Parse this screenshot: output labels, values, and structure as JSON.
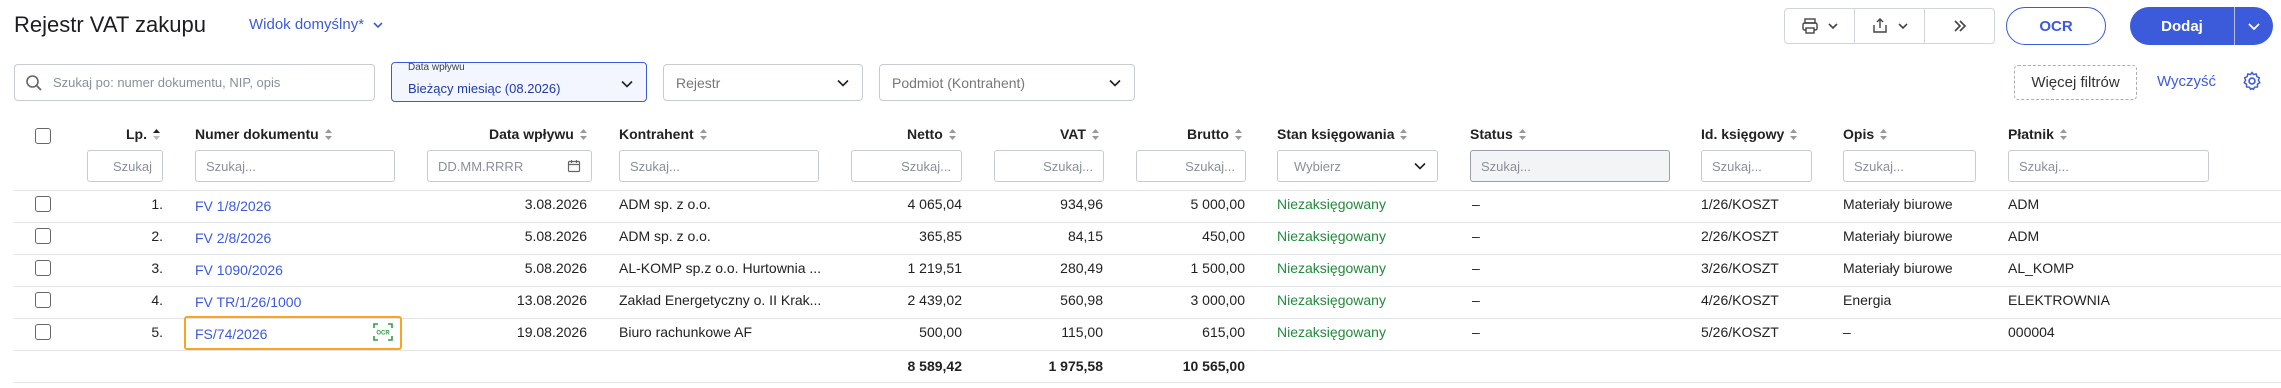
{
  "header": {
    "title": "Rejestr VAT zakupu",
    "view": "Widok domyślny*",
    "ocr_button": "OCR",
    "add_button": "Dodaj"
  },
  "filters": {
    "search_placeholder": "Szukaj po: numer dokumentu, NIP, opis",
    "date_label": "Data wpływu",
    "date_value": "Bieżący miesiąc (08.2026)",
    "register_placeholder": "Rejestr",
    "entity_placeholder": "Podmiot (Kontrahent)",
    "more_filters": "Więcej filtrów",
    "clear": "Wyczyść"
  },
  "columns": {
    "lp": "Lp.",
    "doc_number": "Numer dokumentu",
    "date": "Data wpływu",
    "contractor": "Kontrahent",
    "net": "Netto",
    "vat": "VAT",
    "gross": "Brutto",
    "status_booking": "Stan księgowania",
    "status": "Status",
    "id": "Id. księgowy",
    "desc": "Opis",
    "payer": "Płatnik"
  },
  "column_filters": {
    "lp": "Szukaj",
    "generic": "Szukaj...",
    "date": "DD.MM.RRRR",
    "select": "Wybierz"
  },
  "rows": [
    {
      "lp": "1.",
      "doc": "FV 1/8/2026",
      "date": "3.08.2026",
      "contractor": "ADM sp. z o.o.",
      "net": "4 065,04",
      "vat": "934,96",
      "gross": "5 000,00",
      "booking": "Niezaksięgowany",
      "status": "–",
      "id": "1/26/KOSZT",
      "desc": "Materiały biurowe",
      "payer": "ADM"
    },
    {
      "lp": "2.",
      "doc": "FV 2/8/2026",
      "date": "5.08.2026",
      "contractor": "ADM sp. z o.o.",
      "net": "365,85",
      "vat": "84,15",
      "gross": "450,00",
      "booking": "Niezaksięgowany",
      "status": "–",
      "id": "2/26/KOSZT",
      "desc": "Materiały biurowe",
      "payer": "ADM"
    },
    {
      "lp": "3.",
      "doc": "FV 1090/2026",
      "date": "5.08.2026",
      "contractor": "AL-KOMP sp.z o.o. Hurtownia ...",
      "net": "1 219,51",
      "vat": "280,49",
      "gross": "1 500,00",
      "booking": "Niezaksięgowany",
      "status": "–",
      "id": "3/26/KOSZT",
      "desc": "Materiały biurowe",
      "payer": "AL_KOMP"
    },
    {
      "lp": "4.",
      "doc": "FV TR/1/26/1000",
      "date": "13.08.2026",
      "contractor": "Zakład Energetyczny o. II Krak...",
      "net": "2 439,02",
      "vat": "560,98",
      "gross": "3 000,00",
      "booking": "Niezaksięgowany",
      "status": "–",
      "id": "4/26/KOSZT",
      "desc": "Energia",
      "payer": "ELEKTROWNIA"
    },
    {
      "lp": "5.",
      "doc": "FS/74/2026",
      "date": "19.08.2026",
      "contractor": "Biuro rachunkowe AF",
      "net": "500,00",
      "vat": "115,00",
      "gross": "615,00",
      "booking": "Niezaksięgowany",
      "status": "–",
      "id": "5/26/KOSZT",
      "desc": "–",
      "payer": "000004"
    }
  ],
  "totals": {
    "net": "8 589,42",
    "vat": "1 975,58",
    "gross": "10 565,00"
  },
  "ocr_badge": "OCR",
  "colors": {
    "accent": "#3b5bdb",
    "booking_status": "#228b3b",
    "ocr_highlight": "#f5a623"
  }
}
